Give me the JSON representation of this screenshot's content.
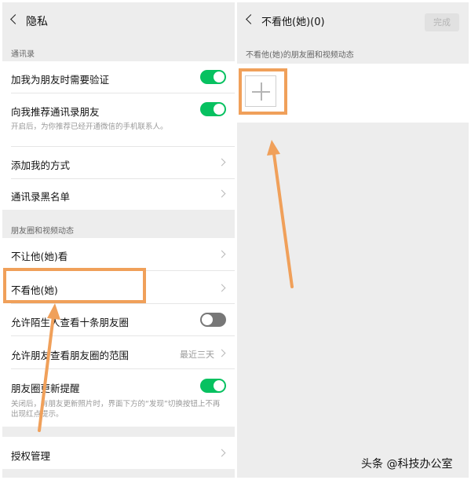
{
  "left": {
    "title": "隐私",
    "contacts_header": "通讯录",
    "add_verify_label": "加我为朋友时需要验证",
    "recommend_label": "向我推荐通讯录朋友",
    "recommend_desc": "开启后，为你推荐已经开通微信的手机联系人。",
    "add_methods_label": "添加我的方式",
    "blacklist_label": "通讯录黑名单",
    "moments_header": "朋友圈和视频动态",
    "hide_mine_label": "不让他(她)看",
    "dont_see_label": "不看他(她)",
    "stranger_label": "允许陌生人查看十条朋友圈",
    "range_label": "允许朋友查看朋友圈的范围",
    "range_value": "最近三天",
    "update_reminder_label": "朋友圈更新提醒",
    "update_reminder_desc": "关闭后，有朋友更新照片时，界面下方的“发现”切换按钮上不再出现红点提示。",
    "auth_label": "授权管理",
    "toggles": {
      "add_verify": true,
      "recommend": true,
      "stranger": false,
      "update_reminder": true
    }
  },
  "right": {
    "title": "不看他(她)(0)",
    "done_label": "完成",
    "section_header": "不看他(她)的朋友圈和视频动态"
  },
  "watermark": "头条 @科技办公室",
  "colors": {
    "toggle_on": "#07c160",
    "toggle_off": "#777777",
    "highlight": "#f0a05a",
    "background": "#ededed"
  },
  "icons": [
    "back-arrow-icon",
    "chevron-right-icon",
    "plus-icon",
    "toggle-switch"
  ]
}
